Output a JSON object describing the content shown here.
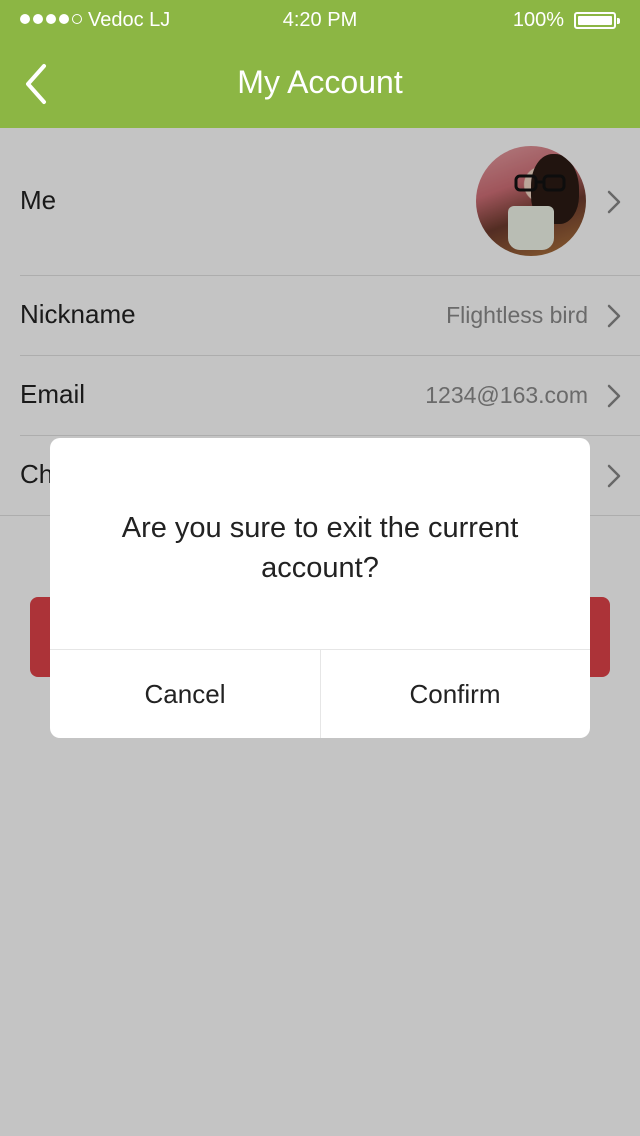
{
  "status_bar": {
    "carrier": "Vedoc LJ",
    "time": "4:20 PM",
    "battery": "100%",
    "signal_bars_filled": 4,
    "signal_bars_total": 5
  },
  "nav": {
    "title": "My Account",
    "back_icon": "chevron-left-icon"
  },
  "rows": [
    {
      "label": "Me",
      "value": ""
    },
    {
      "label": "Nickname",
      "value": "Flightless bird"
    },
    {
      "label": "Email",
      "value": "1234@163.com"
    },
    {
      "label": "Ch",
      "value": ""
    }
  ],
  "dialog": {
    "message": "Are you sure to exit the current account?",
    "cancel_label": "Cancel",
    "confirm_label": "Confirm"
  },
  "colors": {
    "header": "#8cb644",
    "logout_button": "#e0434a"
  }
}
